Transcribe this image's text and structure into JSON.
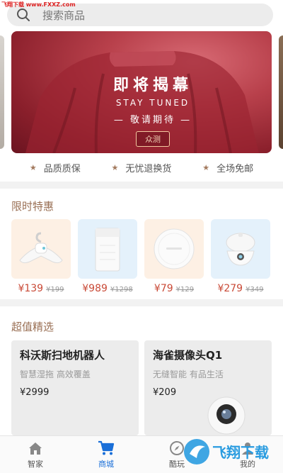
{
  "watermark": "飞翔下载 www.FXXZ.com",
  "search": {
    "placeholder": "搜索商品"
  },
  "banner": {
    "title": "即将揭幕",
    "subtitle": "STAY TUNED",
    "tagline": "— 敬请期待 —",
    "button": "众测"
  },
  "guarantees": [
    {
      "label": "品质质保"
    },
    {
      "label": "无忧退换货"
    },
    {
      "label": "全场免邮"
    }
  ],
  "flash_sale": {
    "title": "限时特惠",
    "items": [
      {
        "price": "¥139",
        "old_price": "¥199",
        "icon": "hanger-icon",
        "bg": "#fdf0e4"
      },
      {
        "price": "¥989",
        "old_price": "¥1298",
        "icon": "air-purifier-icon",
        "bg": "#e4f1fb"
      },
      {
        "price": "¥79",
        "old_price": "¥129",
        "icon": "round-device-icon",
        "bg": "#fdf0e4"
      },
      {
        "price": "¥279",
        "old_price": "¥349",
        "icon": "humidifier-icon",
        "bg": "#e4f1fb"
      }
    ]
  },
  "picks": {
    "title": "超值精选",
    "items": [
      {
        "name": "科沃斯扫地机器人",
        "desc": "智慧湿拖 高效覆盖",
        "price": "¥2999"
      },
      {
        "name": "海雀摄像头Q1",
        "desc": "无缝智能 有品生活",
        "price": "¥209"
      }
    ]
  },
  "tabbar": [
    {
      "label": "智家",
      "icon": "home-icon",
      "active": false
    },
    {
      "label": "商城",
      "icon": "cart-icon",
      "active": true
    },
    {
      "label": "酷玩",
      "icon": "compass-icon",
      "active": false
    },
    {
      "label": "我的",
      "icon": "profile-icon",
      "active": false
    }
  ],
  "colors": {
    "accent": "#1a6fd8",
    "price": "#c94a37",
    "section_title": "#9a7055",
    "banner_red": "#a32a36"
  },
  "brand_logo": "飞翔下载"
}
